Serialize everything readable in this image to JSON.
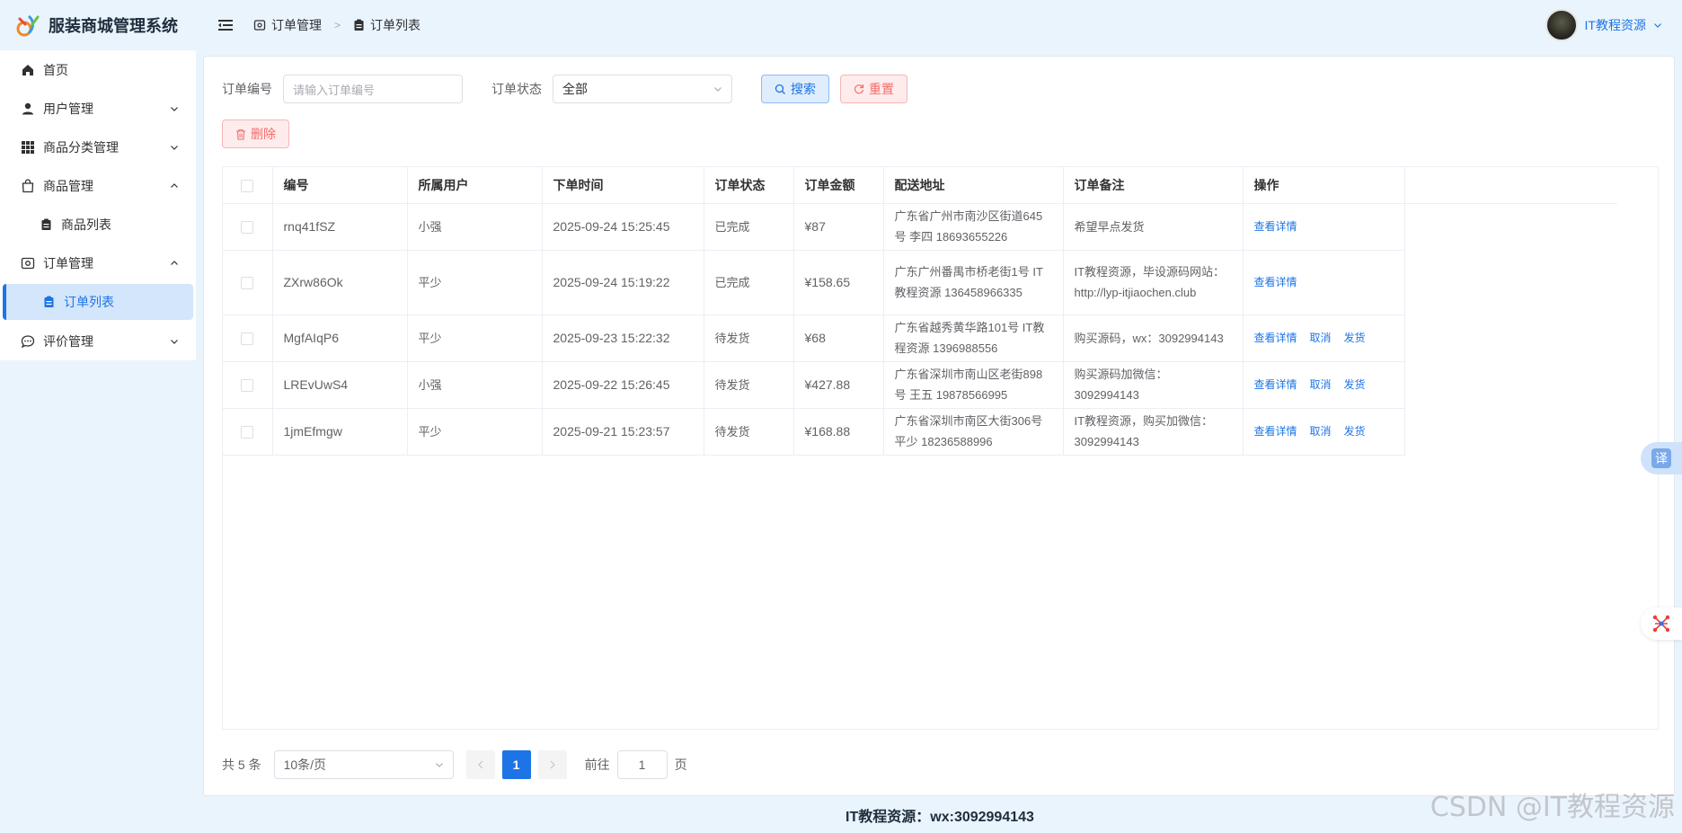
{
  "app": {
    "title": "服装商城管理系统"
  },
  "sidebar": {
    "items": [
      {
        "label": "首页",
        "icon": "home-icon"
      },
      {
        "label": "用户管理",
        "icon": "user-icon",
        "chevron": "down"
      },
      {
        "label": "商品分类管理",
        "icon": "grid-icon",
        "chevron": "down"
      },
      {
        "label": "商品管理",
        "icon": "bag-icon",
        "chevron": "up"
      },
      {
        "label": "商品列表",
        "icon": "clipboard-icon",
        "sub": true
      },
      {
        "label": "订单管理",
        "icon": "order-icon",
        "chevron": "up"
      },
      {
        "label": "订单列表",
        "icon": "clipboard-icon",
        "sub": true,
        "active": true
      },
      {
        "label": "评价管理",
        "icon": "comment-icon",
        "chevron": "down"
      }
    ]
  },
  "header": {
    "breadcrumb": [
      "订单管理",
      "订单列表"
    ],
    "user_name": "IT教程资源"
  },
  "filters": {
    "order_no_label": "订单编号",
    "order_no_placeholder": "请输入订单编号",
    "status_label": "订单状态",
    "status_value": "全部",
    "search_label": "搜索",
    "reset_label": "重置",
    "delete_label": "删除"
  },
  "table": {
    "columns": [
      "编号",
      "所属用户",
      "下单时间",
      "订单状态",
      "订单金额",
      "配送地址",
      "订单备注",
      "操作"
    ],
    "rows": [
      {
        "id": "rnq41fSZ",
        "user": "小强",
        "time": "2025-09-24 15:25:45",
        "status": "已完成",
        "amount": "¥87",
        "address": "广东省广州市南沙区街道645号 李四 18693655226",
        "remark": "希望早点发货",
        "actions": [
          "查看详情"
        ]
      },
      {
        "id": "ZXrw86Ok",
        "user": "平少",
        "time": "2025-09-24 15:19:22",
        "status": "已完成",
        "amount": "¥158.65",
        "address": "广东广州番禺市桥老街1号 IT教程资源 136458966335",
        "remark": "IT教程资源，毕设源码网站：http://lyp-itjiaochen.club",
        "actions": [
          "查看详情"
        ]
      },
      {
        "id": "MgfAIqP6",
        "user": "平少",
        "time": "2025-09-23 15:22:32",
        "status": "待发货",
        "amount": "¥68",
        "address": "广东省越秀黄华路101号 IT教程资源 1396988556",
        "remark": "购买源码，wx：3092994143",
        "actions": [
          "查看详情",
          "取消",
          "发货"
        ]
      },
      {
        "id": "LREvUwS4",
        "user": "小强",
        "time": "2025-09-22 15:26:45",
        "status": "待发货",
        "amount": "¥427.88",
        "address": "广东省深圳市南山区老街898号 王五 19878566995",
        "remark": "购买源码加微信：3092994143",
        "actions": [
          "查看详情",
          "取消",
          "发货"
        ]
      },
      {
        "id": "1jmEfmgw",
        "user": "平少",
        "time": "2025-09-21 15:23:57",
        "status": "待发货",
        "amount": "¥168.88",
        "address": "广东省深圳市南区大街306号 平少 18236588996",
        "remark": "IT教程资源，购买加微信：3092994143",
        "actions": [
          "查看详情",
          "取消",
          "发货"
        ]
      }
    ]
  },
  "pagination": {
    "total_text": "共 5 条",
    "page_size": "10条/页",
    "current_page": "1",
    "goto_label": "前往",
    "goto_value": "1",
    "page_suffix": "页"
  },
  "footer": {
    "text": "IT教程资源：wx:3092994143"
  },
  "watermark": "CSDN @IT教程资源",
  "floating": {
    "translate_label": "译"
  },
  "colors": {
    "primary": "#1d74e6",
    "danger": "#f56c6c",
    "bg": "#eaf4fd"
  }
}
